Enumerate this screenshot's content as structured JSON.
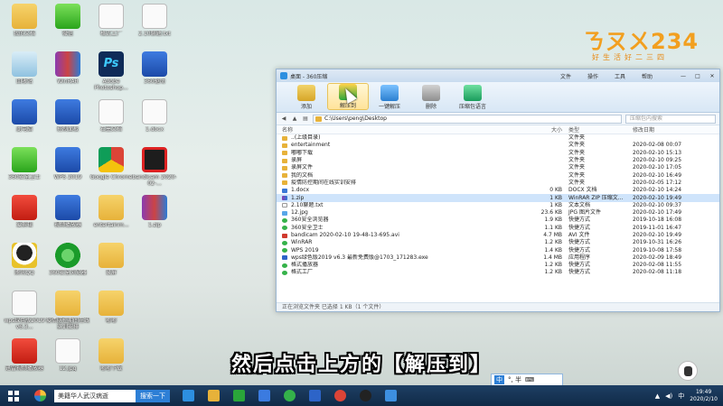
{
  "desktop_icons": [
    {
      "label": "我的文档",
      "kind": "folder",
      "col": 0,
      "row": 0
    },
    {
      "label": "微信",
      "kind": "green",
      "col": 1,
      "row": 0
    },
    {
      "label": "格式工厂",
      "kind": "white",
      "col": 2,
      "row": 0
    },
    {
      "label": "2.10聊题.txt",
      "kind": "white",
      "col": 3,
      "row": 0
    },
    {
      "label": "回收站",
      "kind": "rec",
      "col": 0,
      "row": 1
    },
    {
      "label": "WinRAR",
      "kind": "rar",
      "col": 1,
      "row": 1
    },
    {
      "label": "Adobe Photoshop...",
      "kind": "ps",
      "col": 2,
      "row": 1
    },
    {
      "label": "360驱动",
      "kind": "blue",
      "col": 3,
      "row": 1
    },
    {
      "label": "此电脑",
      "kind": "blue",
      "col": 0,
      "row": 2
    },
    {
      "label": "控制面板",
      "kind": "blue",
      "col": 1,
      "row": 2
    },
    {
      "label": "石墨文档",
      "kind": "white",
      "col": 2,
      "row": 2
    },
    {
      "label": "1.docx",
      "kind": "white",
      "col": 3,
      "row": 2
    },
    {
      "label": "360安全卫士",
      "kind": "green",
      "col": 0,
      "row": 3
    },
    {
      "label": "WPS 2019",
      "kind": "blue",
      "col": 1,
      "row": 3
    },
    {
      "label": "Google Chrome",
      "kind": "chrome",
      "col": 2,
      "row": 3
    },
    {
      "label": "bandicam 2020-02-...",
      "kind": "black",
      "col": 3,
      "row": 3
    },
    {
      "label": "爱剪辑",
      "kind": "red",
      "col": 0,
      "row": 4
    },
    {
      "label": "视频播放器",
      "kind": "blue",
      "col": 1,
      "row": 4
    },
    {
      "label": "entertainm...",
      "kind": "folder",
      "col": 2,
      "row": 4
    },
    {
      "label": "1.zip",
      "kind": "rar",
      "col": 3,
      "row": 4
    },
    {
      "label": "腾讯QQ",
      "kind": "qq",
      "col": 0,
      "row": 5
    },
    {
      "label": "360安全浏览器",
      "kind": "ie",
      "col": 1,
      "row": 5
    },
    {
      "label": "录屏",
      "kind": "folder",
      "col": 2,
      "row": 5
    },
    {
      "label": "wps绿色版2019 v6.3...",
      "kind": "white",
      "col": 0,
      "row": 6
    },
    {
      "label": "疫情防控期间在线实训安排",
      "kind": "folder",
      "col": 1,
      "row": 6
    },
    {
      "label": "嘟嘟",
      "kind": "folder",
      "col": 2,
      "row": 6
    },
    {
      "label": "迅雷视频播放器",
      "kind": "red",
      "col": 0,
      "row": 7
    },
    {
      "label": "12.jpg",
      "kind": "white",
      "col": 1,
      "row": 7
    },
    {
      "label": "嘟嘟下载",
      "kind": "folder",
      "col": 2,
      "row": 7
    }
  ],
  "brand": {
    "mark": "ㄋㄡㄨ234",
    "sub": "好生活好二三四"
  },
  "window": {
    "title": "桌面 - 360压缩",
    "menus": [
      "文件",
      "操作",
      "工具",
      "帮助"
    ],
    "controls": [
      "—",
      "□",
      "✕"
    ],
    "tools": [
      {
        "label": "添加",
        "kind": "add"
      },
      {
        "label": "解压到",
        "kind": "ext",
        "active": true
      },
      {
        "label": "一键解压",
        "kind": "one"
      },
      {
        "label": "删除",
        "kind": "del"
      },
      {
        "label": "压缩包语言",
        "kind": "cmt"
      }
    ],
    "path": "C:\\Users\\peng\\Desktop",
    "search_placeholder": "压缩包内搜索",
    "columns": {
      "name": "名称",
      "size": "大小",
      "type": "类型",
      "date": "修改日期"
    },
    "files": [
      {
        "name": "..(上级目录)",
        "size": "",
        "type": "文件夹",
        "date": "",
        "icon": "folder"
      },
      {
        "name": "entertainment",
        "size": "",
        "type": "文件夹",
        "date": "2020-02-08 00:07",
        "icon": "folder"
      },
      {
        "name": "嘟嘟下载",
        "size": "",
        "type": "文件夹",
        "date": "2020-02-10 15:13",
        "icon": "folder"
      },
      {
        "name": "录屏",
        "size": "",
        "type": "文件夹",
        "date": "2020-02-10 09:25",
        "icon": "folder"
      },
      {
        "name": "录屏文件",
        "size": "",
        "type": "文件夹",
        "date": "2020-02-10 17:05",
        "icon": "folder"
      },
      {
        "name": "我的文档",
        "size": "",
        "type": "文件夹",
        "date": "2020-02-10 16:49",
        "icon": "folder"
      },
      {
        "name": "疫情防控期间在线实训安排",
        "size": "",
        "type": "文件夹",
        "date": "2020-02-05 17:12",
        "icon": "folder"
      },
      {
        "name": "1.docx",
        "size": "0 KB",
        "type": "DOCX 文档",
        "date": "2020-02-10 14:24",
        "icon": "doc"
      },
      {
        "name": "1.zip",
        "size": "1 KB",
        "type": "WinRAR ZIP 压缩文...",
        "date": "2020-02-10 19:49",
        "icon": "zip",
        "selected": true
      },
      {
        "name": "2.10聊题.txt",
        "size": "1 KB",
        "type": "文本文档",
        "date": "2020-02-10 09:37",
        "icon": "txt"
      },
      {
        "name": "12.jpg",
        "size": "23.6 KB",
        "type": "JPG 图片文件",
        "date": "2020-02-10 17:49",
        "icon": "jpg"
      },
      {
        "name": "360安全浏览器",
        "size": "1.9 KB",
        "type": "快捷方式",
        "date": "2019-10-18 16:08",
        "icon": "lnk"
      },
      {
        "name": "360安全卫士",
        "size": "1.1 KB",
        "type": "快捷方式",
        "date": "2019-11-01 16:47",
        "icon": "lnk"
      },
      {
        "name": "bandicam 2020-02-10 19-48-13-695.avi",
        "size": "4.7 MB",
        "type": "AVI 文件",
        "date": "2020-02-10 19:49",
        "icon": "avi"
      },
      {
        "name": "WinRAR",
        "size": "1.2 KB",
        "type": "快捷方式",
        "date": "2019-10-31 16:26",
        "icon": "lnk"
      },
      {
        "name": "WPS 2019",
        "size": "1.4 KB",
        "type": "快捷方式",
        "date": "2019-10-08 17:58",
        "icon": "lnk"
      },
      {
        "name": "wps绿色版2019 v6.3 最新免费版@1703_171283.exe",
        "size": "1.4 MB",
        "type": "应用程序",
        "date": "2020-02-09 18:49",
        "icon": "exe"
      },
      {
        "name": "格式播放器",
        "size": "1.2 KB",
        "type": "快捷方式",
        "date": "2020-02-08 11:55",
        "icon": "lnk"
      },
      {
        "name": "格式工厂",
        "size": "1.2 KB",
        "type": "快捷方式",
        "date": "2020-02-08 11:18",
        "icon": "lnk"
      }
    ],
    "status": "正在浏览文件夹 已选择 1 KB（1 个文件）"
  },
  "subtitle": "然后点击上方的【解压到】",
  "ime": {
    "mode": "中",
    "symbols": "°, 半"
  },
  "taskbar": {
    "search_text": "美籍华人武汉病逝",
    "search_button": "搜索一下",
    "apps": [
      "360",
      "ie",
      "explorer",
      "store",
      "baidu",
      "360browser",
      "wps",
      "chrome",
      "bandicam",
      "360zip"
    ],
    "tray_lang": "中",
    "time": "19:49",
    "date": "2020/2/10"
  },
  "colors": {
    "accent": "#2d7fd6",
    "selected_row": "#cfe4fb",
    "brand": "#f29f1f",
    "taskbar": "#102a47"
  }
}
